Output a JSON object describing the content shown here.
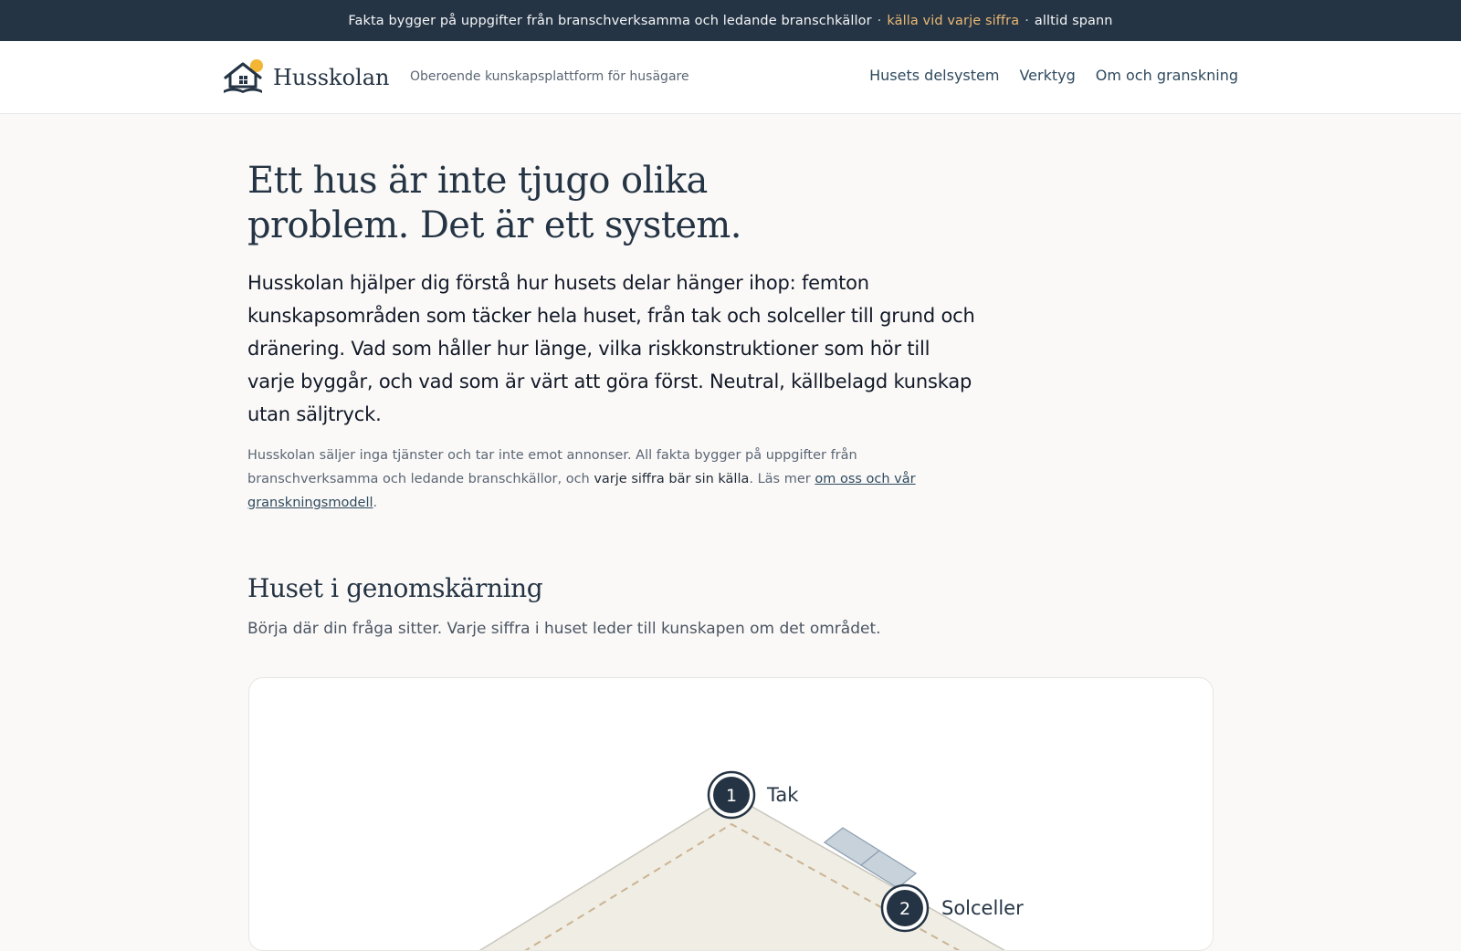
{
  "topbar": {
    "text": "Fakta bygger på uppgifter från branschverksamma och ledande branschkällor",
    "sep1": "·",
    "highlight": "källa vid varje siffra",
    "sep2": "·",
    "tail": "alltid spann"
  },
  "brand": {
    "name": "Husskolan",
    "tagline": "Oberoende kunskapsplattform för husägare",
    "logo_icon": "house-logo-icon",
    "accent": "#f2b634"
  },
  "nav": {
    "items": [
      {
        "label": "Husets delsystem"
      },
      {
        "label": "Verktyg"
      },
      {
        "label": "Om och granskning"
      }
    ]
  },
  "hero": {
    "title": "Ett hus är inte tjugo olika problem. Det är ett system.",
    "lead": "Husskolan hjälper dig förstå hur husets delar hänger ihop: femton kunskapsområden som täcker hela huset, från tak och solceller till grund och dränering. Vad som håller hur länge, vilka riskkonstruktioner som hör till varje byggår, och vad som är värt att göra först. Neutral, källbelagd kunskap utan säljtryck.",
    "note_part1": "Husskolan säljer inga tjänster och tar inte emot annonser. All fakta bygger på uppgifter från branschverksamma och ledande branschkällor, och",
    "note_bold": "varje siffra bär sin källa",
    "note_part2": ". Läs mer",
    "note_link": "om oss och vår granskningsmodell",
    "note_end": "."
  },
  "section": {
    "title": "Huset i genomskärning",
    "subtitle": "Börja där din fråga sitter. Varje siffra i huset leder till kunskapen om det området."
  },
  "diagram": {
    "markers": [
      {
        "number": "1",
        "label": "Tak"
      },
      {
        "number": "2",
        "label": "Solceller"
      }
    ]
  },
  "colors": {
    "navy": "#253444",
    "accent_text": "#e9b872",
    "background": "#faf9f7"
  }
}
